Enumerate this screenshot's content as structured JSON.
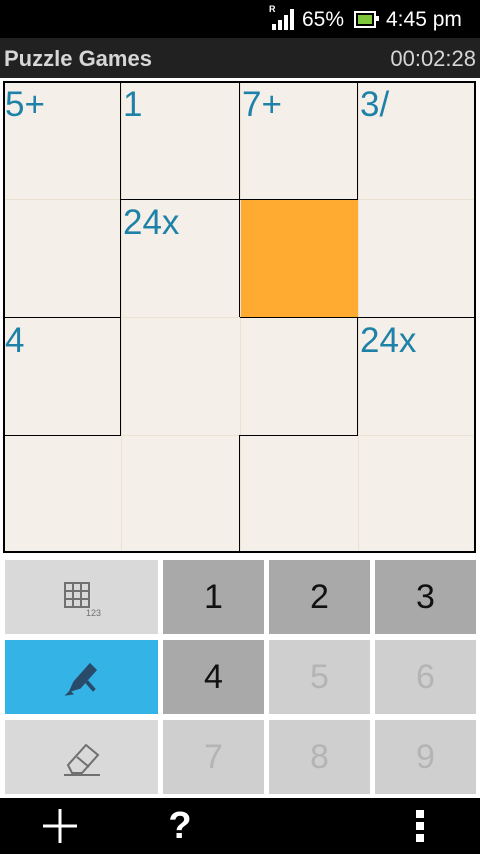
{
  "status": {
    "battery_pct": "65%",
    "time": "4:45 pm",
    "roaming": "R"
  },
  "header": {
    "title": "Puzzle Games",
    "timer": "00:02:28"
  },
  "grid": {
    "cells": [
      {
        "clue": "5+"
      },
      {
        "clue": "1"
      },
      {
        "clue": "7+"
      },
      {
        "clue": "3/"
      },
      {
        "clue": ""
      },
      {
        "clue": "24x"
      },
      {
        "clue": "",
        "selected": true
      },
      {
        "clue": ""
      },
      {
        "clue": "4"
      },
      {
        "clue": ""
      },
      {
        "clue": ""
      },
      {
        "clue": "24x"
      },
      {
        "clue": ""
      },
      {
        "clue": ""
      },
      {
        "clue": ""
      },
      {
        "clue": ""
      }
    ],
    "selected_color": "#ffab32",
    "clue_color": "#1e82a8"
  },
  "keypad": {
    "numbers": [
      {
        "label": "1",
        "enabled": true
      },
      {
        "label": "2",
        "enabled": true
      },
      {
        "label": "3",
        "enabled": true
      },
      {
        "label": "4",
        "enabled": true
      },
      {
        "label": "5",
        "enabled": false
      },
      {
        "label": "6",
        "enabled": false
      },
      {
        "label": "7",
        "enabled": false
      },
      {
        "label": "8",
        "enabled": false
      },
      {
        "label": "9",
        "enabled": false
      }
    ],
    "tools": [
      {
        "name": "grid-icon",
        "caption": "123"
      },
      {
        "name": "pen-icon",
        "active": true
      },
      {
        "name": "eraser-icon"
      }
    ],
    "active_color": "#33b3e6"
  },
  "bottombar": {
    "help_label": "?"
  }
}
